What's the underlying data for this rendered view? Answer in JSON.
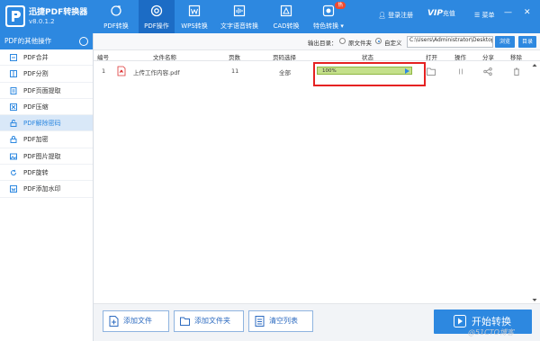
{
  "app": {
    "name": "迅捷PDF转换器",
    "version": "v8.0.1.2"
  },
  "nav": {
    "tabs": [
      {
        "label": "PDF转换",
        "icon": "refresh-icon"
      },
      {
        "label": "PDF操作",
        "icon": "target-icon",
        "active": true
      },
      {
        "label": "WPS转换",
        "icon": "wps-icon"
      },
      {
        "label": "文字语音转换",
        "icon": "audio-bars-icon"
      },
      {
        "label": "CAD转换",
        "icon": "cad-icon"
      },
      {
        "label": "特色转换",
        "icon": "feature-icon",
        "badge": "热"
      }
    ],
    "login": "登录注册",
    "vip": "VIP",
    "recharge": "充值",
    "menu": "菜单"
  },
  "sidebar": {
    "header": "PDF的其他操作",
    "items": [
      {
        "label": "PDF合并",
        "icon": "merge-icon"
      },
      {
        "label": "PDF分割",
        "icon": "split-icon"
      },
      {
        "label": "PDF页面提取",
        "icon": "page-extract-icon"
      },
      {
        "label": "PDF压缩",
        "icon": "compress-icon"
      },
      {
        "label": "PDF解除密码",
        "icon": "unlock-icon",
        "active": true
      },
      {
        "label": "PDF加密",
        "icon": "lock-icon"
      },
      {
        "label": "PDF图片提取",
        "icon": "image-extract-icon"
      },
      {
        "label": "PDF旋转",
        "icon": "rotate-icon"
      },
      {
        "label": "PDF添加水印",
        "icon": "watermark-icon"
      }
    ]
  },
  "output": {
    "label": "输出目录：",
    "option_original": "原文件夹",
    "option_custom": "自定义",
    "selected": "自定义",
    "path": "C:\\Users\\Administrator\\Desktop",
    "browse": "浏览",
    "open_dir": "目录"
  },
  "table": {
    "columns": [
      "编号",
      "文件名称",
      "页数",
      "页码选择",
      "状态",
      "打开",
      "操作",
      "分享",
      "移除"
    ],
    "rows": [
      {
        "index": "1",
        "filename": "上传工作内容.pdf",
        "pages": "11",
        "page_select": "全部",
        "progress_text": "100%",
        "progress": 1.0
      }
    ]
  },
  "bottom": {
    "add_file": "添加文件",
    "add_folder": "添加文件夹",
    "clear_list": "清空列表",
    "start": "开始转换"
  },
  "watermark": "@51CTO博客",
  "colors": {
    "primary": "#2d88e0",
    "highlight": "#e52222",
    "progress": "#c4e08a"
  }
}
